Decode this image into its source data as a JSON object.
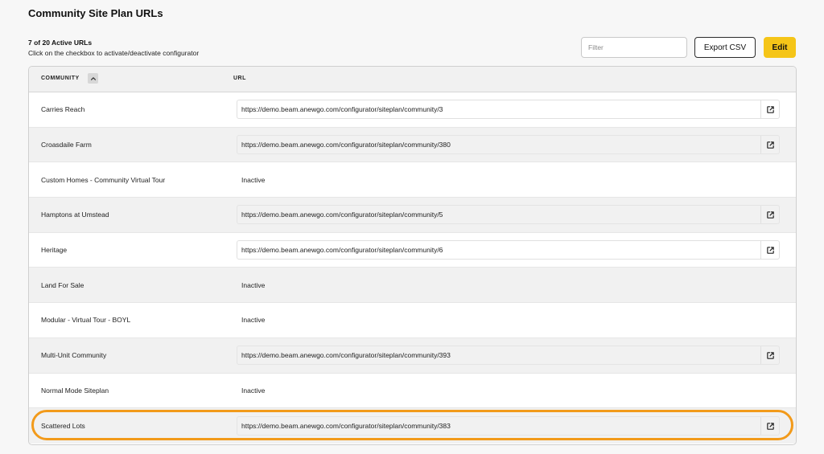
{
  "page": {
    "title": "Community Site Plan URLs",
    "summary": "7 of 20 Active URLs",
    "hint": "Click on the checkbox to activate/deactivate configurator"
  },
  "toolbar": {
    "filter_placeholder": "Filter",
    "filter_value": "",
    "export_label": "Export CSV",
    "edit_label": "Edit"
  },
  "table": {
    "columns": {
      "community": "COMMUNITY",
      "url": "URL"
    },
    "sort": {
      "column": "community",
      "direction": "ascending"
    },
    "rows": [
      {
        "community": "Carries Reach",
        "status": "active",
        "url": "https://demo.beam.anewgo.com/configurator/siteplan/community/3"
      },
      {
        "community": "Croasdaile Farm",
        "status": "active",
        "url": "https://demo.beam.anewgo.com/configurator/siteplan/community/380"
      },
      {
        "community": "Custom Homes - Community Virtual Tour",
        "status": "inactive",
        "url": "Inactive"
      },
      {
        "community": "Hamptons at Umstead",
        "status": "active",
        "url": "https://demo.beam.anewgo.com/configurator/siteplan/community/5"
      },
      {
        "community": "Heritage",
        "status": "active",
        "url": "https://demo.beam.anewgo.com/configurator/siteplan/community/6"
      },
      {
        "community": "Land For Sale",
        "status": "inactive",
        "url": "Inactive"
      },
      {
        "community": "Modular - Virtual Tour - BOYL",
        "status": "inactive",
        "url": "Inactive"
      },
      {
        "community": "Multi-Unit Community",
        "status": "active",
        "url": "https://demo.beam.anewgo.com/configurator/siteplan/community/393"
      },
      {
        "community": "Normal Mode Siteplan",
        "status": "inactive",
        "url": "Inactive"
      },
      {
        "community": "Scattered Lots",
        "status": "active",
        "url": "https://demo.beam.anewgo.com/configurator/siteplan/community/383",
        "highlighted": true
      }
    ]
  },
  "colors": {
    "accent": "#f5c518",
    "highlight": "#f29a1a",
    "row_alt": "#f1f1f1"
  },
  "icons": {
    "sort": "chevron-up-icon",
    "open_link": "external-link-icon"
  }
}
